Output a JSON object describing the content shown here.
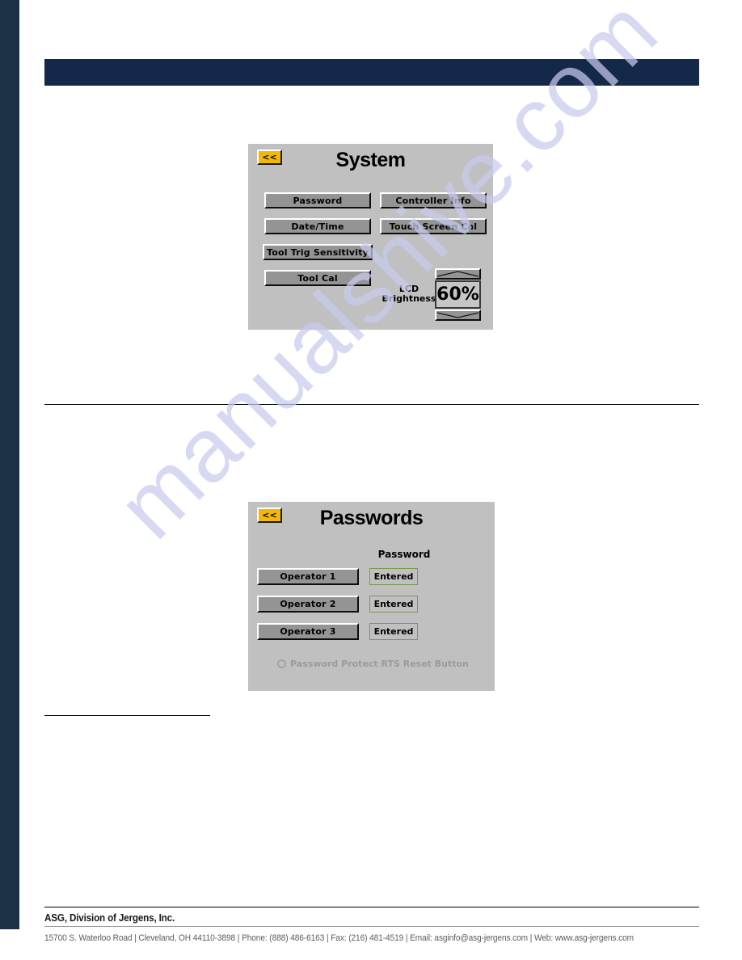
{
  "document": {
    "header_bar_color": "#14284a",
    "left_rail_color": "#1d3146",
    "watermark_text": "manualshive.com"
  },
  "system_panel": {
    "title": "System",
    "back_label": "<<",
    "left_buttons": [
      {
        "label": "Password"
      },
      {
        "label": "Date/Time"
      },
      {
        "label": "Tool Trig Sensitivity"
      },
      {
        "label": "Tool Cal"
      }
    ],
    "right_buttons": [
      {
        "label": "Controller Info"
      },
      {
        "label": "Touch Screen Cal"
      }
    ],
    "lcd": {
      "label_line1": "LCD",
      "label_line2": "Brightness",
      "value": "60%",
      "up_icon": "chevron-up-icon",
      "down_icon": "chevron-down-icon"
    }
  },
  "passwords_panel": {
    "title": "Passwords",
    "back_label": "<<",
    "column_header": "Password",
    "rows": [
      {
        "operator": "Operator 1",
        "status": "Entered"
      },
      {
        "operator": "Operator 2",
        "status": "Entered"
      },
      {
        "operator": "Operator 3",
        "status": "Entered"
      }
    ],
    "rts_option": {
      "label": "Password Protect RTS Reset Button",
      "checked": false
    },
    "status_border_color": "#7a9a52"
  },
  "footer": {
    "company": "ASG, Division of Jergens, Inc.",
    "contact": "15700 S. Waterloo Road | Cleveland, OH 44110-3898 | Phone: (888) 486-6163 | Fax: (216) 481-4519 | Email: asginfo@asg-jergens.com | Web: www.asg-jergens.com"
  }
}
